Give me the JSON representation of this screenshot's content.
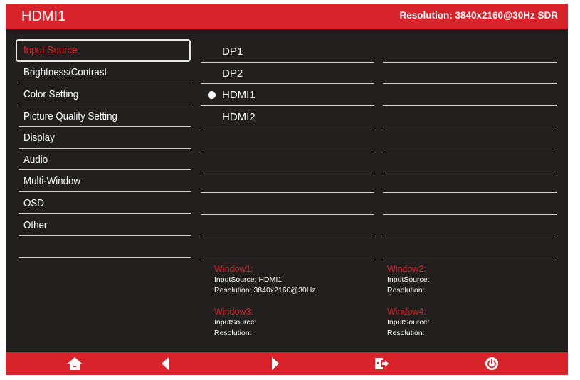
{
  "header": {
    "title": "HDMI1",
    "resolution": "Resolution: 3840x2160@30Hz SDR"
  },
  "menu": {
    "items": [
      {
        "label": "Input Source"
      },
      {
        "label": "Brightness/Contrast"
      },
      {
        "label": "Color Setting"
      },
      {
        "label": "Picture Quality Setting"
      },
      {
        "label": "Display"
      },
      {
        "label": "Audio"
      },
      {
        "label": "Multi-Window"
      },
      {
        "label": "OSD"
      },
      {
        "label": "Other"
      }
    ],
    "selected": "Input Source"
  },
  "input_options": [
    {
      "label": "DP1"
    },
    {
      "label": "DP2"
    },
    {
      "label": "HDMI1"
    },
    {
      "label": "HDMI2"
    }
  ],
  "selected_input": "HDMI1",
  "windows": {
    "window1": {
      "title": "Window1:",
      "input": "InputSource: HDMI1",
      "resolution": "Resolution: 3840x2160@30Hz"
    },
    "window2": {
      "title": "Window2:",
      "input": "InputSource:",
      "resolution": "Resolution:"
    },
    "window3": {
      "title": "Window3:",
      "input": "InputSource:",
      "resolution": "Resolution:"
    },
    "window4": {
      "title": "Window4:",
      "input": "InputSource:",
      "resolution": "Resolution:"
    }
  },
  "footer_icons": [
    "home-icon",
    "arrow-left-icon",
    "arrow-right-icon",
    "exit-icon",
    "power-icon"
  ],
  "colors": {
    "accent": "#d9232a",
    "background": "#231f1f",
    "text": "#ffffff"
  }
}
